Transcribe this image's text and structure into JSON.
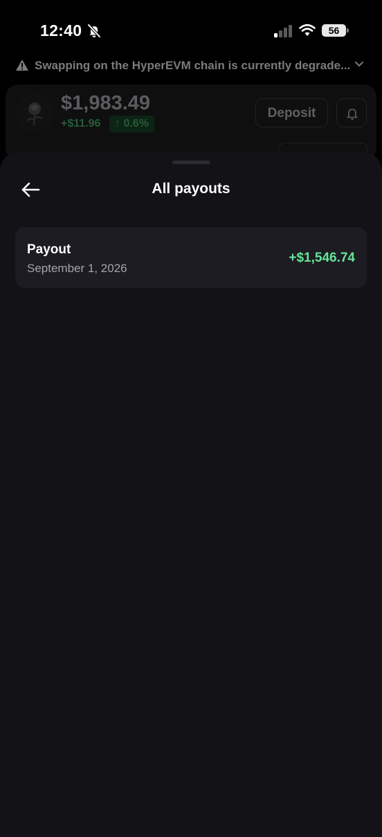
{
  "status_bar": {
    "time": "12:40",
    "battery": "56"
  },
  "background": {
    "warning": "Swapping on the HyperEVM chain is currently degrade...",
    "balance": "$1,983.49",
    "change_amount": "+$11.96",
    "change_percent": "↑ 0.6%",
    "deposit_label": "Deposit"
  },
  "sheet": {
    "title": "All payouts",
    "payouts": [
      {
        "label": "Payout",
        "date": "September 1, 2026",
        "amount": "+$1,546.74"
      }
    ]
  },
  "colors": {
    "sheet_bg": "#121217",
    "card_bg": "#1c1c22",
    "positive": "#67e59a"
  }
}
